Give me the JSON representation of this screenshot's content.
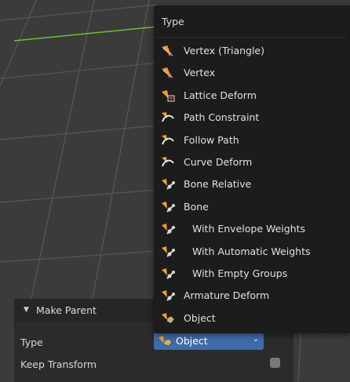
{
  "menu": {
    "title": "Type",
    "items": [
      {
        "label": "Vertex (Triangle)",
        "icon": "vertex-parent-icon",
        "indent": false
      },
      {
        "label": "Vertex",
        "icon": "vertex-parent-icon",
        "indent": false
      },
      {
        "label": "Lattice Deform",
        "icon": "lattice-icon",
        "indent": false
      },
      {
        "label": "Path Constraint",
        "icon": "curve-icon",
        "indent": false
      },
      {
        "label": "Follow Path",
        "icon": "curve-icon",
        "indent": false
      },
      {
        "label": "Curve Deform",
        "icon": "curve-icon",
        "indent": false
      },
      {
        "label": "Bone Relative",
        "icon": "armature-icon",
        "indent": false
      },
      {
        "label": "Bone",
        "icon": "armature-icon",
        "indent": false
      },
      {
        "label": "With Envelope Weights",
        "icon": "armature-icon",
        "indent": true
      },
      {
        "label": "With Automatic Weights",
        "icon": "armature-icon",
        "indent": true
      },
      {
        "label": "With Empty Groups",
        "icon": "armature-icon",
        "indent": true
      },
      {
        "label": "Armature Deform",
        "icon": "armature-icon",
        "indent": false
      },
      {
        "label": "Object",
        "icon": "object-icon",
        "indent": false
      }
    ]
  },
  "panel": {
    "title": "Make Parent",
    "type_label": "Type",
    "type_value": "Object",
    "keep_transform_label": "Keep Transform",
    "keep_transform_checked": false
  },
  "colors": {
    "dropdown_selected": "#3f6ba8",
    "menu_bg": "#1c1c1c",
    "panel_bg": "#2b2b2b",
    "viewport_grid": "#5a5a5a",
    "x_axis": "#6fbf3a"
  }
}
